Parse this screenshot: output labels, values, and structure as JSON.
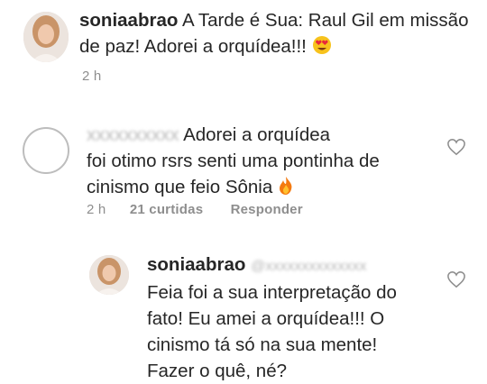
{
  "post": {
    "username": "soniaabrao",
    "caption": "A Tarde é Sua: Raul Gil em missão de paz! Adorei a orquídea!!!",
    "time": "2 h",
    "emoji_icon": "heart-eyes-emoji"
  },
  "comment": {
    "line1": "Adorei a orquídea",
    "line2": "foi otimo rsrs senti uma pontinha  de",
    "line3": "cinismo que feio Sônia",
    "emoji_icon": "fire-emoji",
    "time": "2 h",
    "likes": "21 curtidas",
    "reply_label": "Responder"
  },
  "reply": {
    "username": "soniaabrao",
    "line1": "Feia foi a sua interpretação do",
    "line2": "fato! Eu amei a orquídea!!! O",
    "line3": "cinismo tá só na sua mente!",
    "line4": "Fazer o quê, né?"
  },
  "colors": {
    "text": "#262626",
    "secondary": "#8e8e8e"
  }
}
